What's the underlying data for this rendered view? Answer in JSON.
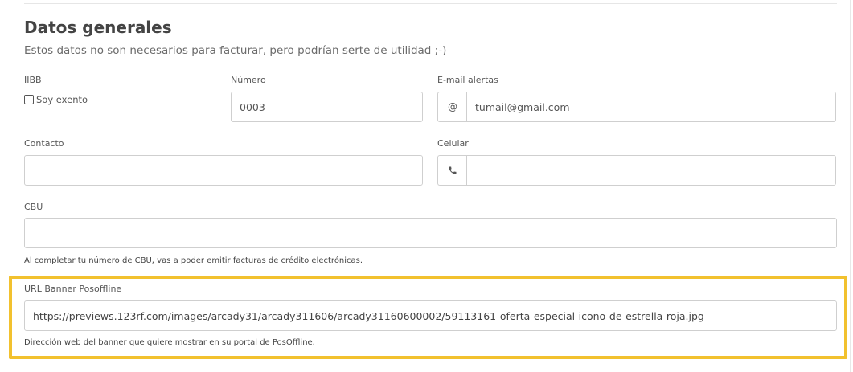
{
  "section": {
    "title": "Datos generales",
    "subtitle": "Estos datos no son necesarios para facturar, pero podrían serte de utilidad ;-)"
  },
  "iibb": {
    "label": "IIBB",
    "checkbox_label": "Soy exento",
    "checked": false
  },
  "numero": {
    "label": "Número",
    "value": "0003"
  },
  "email": {
    "label": "E-mail alertas",
    "addon": "@",
    "value": "tumail@gmail.com"
  },
  "contacto": {
    "label": "Contacto",
    "value": ""
  },
  "celular": {
    "label": "Celular",
    "icon": "phone-icon",
    "value": ""
  },
  "cbu": {
    "label": "CBU",
    "value": "",
    "help": "Al completar tu número de CBU, vas a poder emitir facturas de crédito electrónicas."
  },
  "banner": {
    "label": "URL Banner Posoffline",
    "value": "https://previews.123rf.com/images/arcady31/arcady311606/arcady31160600002/59113161-oferta-especial-icono-de-estrella-roja.jpg",
    "help": "Dirección web del banner que quiere mostrar en su portal de PosOffline."
  },
  "colors": {
    "highlight": "#f2c12e",
    "border": "#cfcfcf"
  }
}
